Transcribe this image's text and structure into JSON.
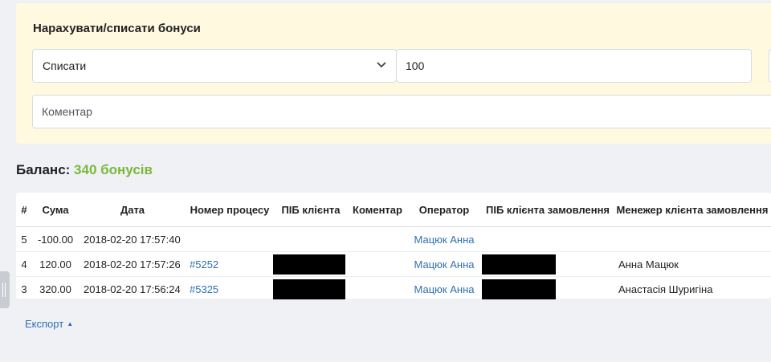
{
  "form": {
    "title": "Нарахувати/списати бонуси",
    "action_selected": "Списати",
    "amount_value": "100",
    "comment_placeholder": "Коментар"
  },
  "balance": {
    "label": "Баланс:",
    "value": "340 бонусів"
  },
  "table": {
    "headers": [
      "#",
      "Сума",
      "Дата",
      "Номер процесу",
      "ПІБ клієнта",
      "Коментар",
      "Оператор",
      "ПІБ клієнта замовлення",
      "Менежер клієнта замовлення"
    ],
    "rows": [
      {
        "id": "5",
        "sum": "-100.00",
        "date": "2018-02-20 17:57:40",
        "process": "",
        "client_redacted": false,
        "comment": "",
        "operator": "Мацюк Анна",
        "order_client_redacted": false,
        "manager": ""
      },
      {
        "id": "4",
        "sum": "120.00",
        "date": "2018-02-20 17:57:26",
        "process": "#5252",
        "client_redacted": true,
        "comment": "",
        "operator": "Мацюк Анна",
        "order_client_redacted": true,
        "manager": "Анна Мацюк"
      },
      {
        "id": "3",
        "sum": "320.00",
        "date": "2018-02-20 17:56:24",
        "process": "#5325",
        "client_redacted": true,
        "comment": "",
        "operator": "Мацюк Анна",
        "order_client_redacted": true,
        "manager": "Анастасія Шуригіна"
      }
    ]
  },
  "export": {
    "label": "Експорт"
  },
  "colors": {
    "panel_bg": "#fff9e0",
    "balance_accent": "#7ab83a",
    "link": "#2f6fb3"
  },
  "icons": [
    "chevron-down-icon",
    "caret-up-icon",
    "drag-handle-icon"
  ]
}
